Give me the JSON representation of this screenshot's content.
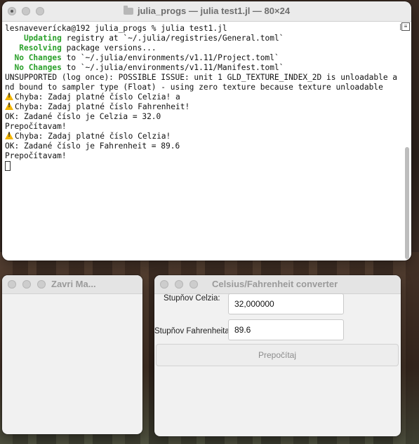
{
  "terminal": {
    "title": "julia_progs — julia test1.jl — 80×24",
    "lines": {
      "l1": "lesnaveverícka@192 julia_progs % julia test1.jl",
      "l2_key": "Updating",
      "l2_rest": " registry at `~/.julia/registries/General.toml`",
      "l3_key": "Resolving",
      "l3_rest": " package versions...",
      "l4_key": "No Changes",
      "l4_rest": " to `~/.julia/environments/v1.11/Project.toml`",
      "l5_key": "No Changes",
      "l5_rest": " to `~/.julia/environments/v1.11/Manifest.toml`",
      "l6": "UNSUPPORTED (log once): POSSIBLE ISSUE: unit 1 GLD_TEXTURE_INDEX_2D is unloadable and bound to sampler type (Float) - using zero texture because texture unloadable",
      "l7": "Chyba: Zadaj platné číslo Celzia! a",
      "l8": "Chyba: Zadaj platné číslo Fahrenheit!",
      "l9": "OK: Zadané číslo je Celzia = 32.0",
      "l10": "Prepočítavam!",
      "l11": "Chyba: Zadaj platné číslo Celzia!",
      "l12": "OK: Zadané číslo je Fahrenheit = 89.6",
      "l13": "Prepočítavam!"
    }
  },
  "zavri": {
    "title": "Zavri Ma..."
  },
  "converter": {
    "title": "Celsius/Fahrenheit converter",
    "celsius_label": "Stupňov Celzia:",
    "celsius_value": "32,000000",
    "fahrenheit_label": "Stupňov Fahrenheita:",
    "fahrenheit_value": "89.6",
    "button_label": "Prepočítaj"
  },
  "colors": {
    "accent_green": "#2aa02a",
    "warning_yellow": "#f2b400"
  },
  "icons": [
    "folder-icon",
    "warning-icon",
    "window-close-icon",
    "window-minimize-icon",
    "window-zoom-icon"
  ]
}
